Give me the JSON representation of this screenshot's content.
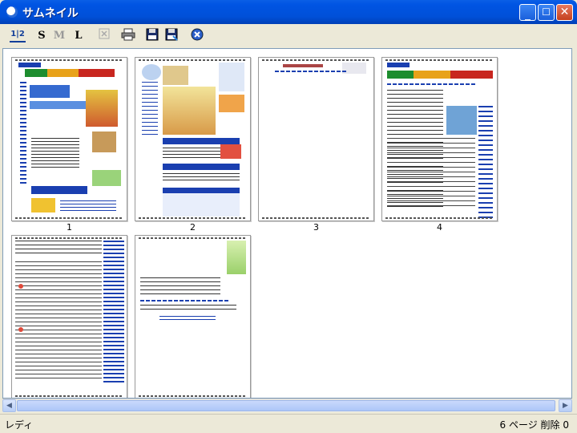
{
  "window": {
    "title": "サムネイル"
  },
  "toolbar": {
    "tools": [
      {
        "name": "page-order-icon",
        "label": "1|2"
      },
      {
        "name": "size-small-button",
        "label": "S"
      },
      {
        "name": "size-medium-button",
        "label": "M"
      },
      {
        "name": "size-large-button",
        "label": "L"
      },
      {
        "name": "delete-icon",
        "label": ""
      },
      {
        "name": "print-icon",
        "label": ""
      },
      {
        "name": "save-icon",
        "label": ""
      },
      {
        "name": "save-as-icon",
        "label": ""
      },
      {
        "name": "close-doc-icon",
        "label": ""
      }
    ]
  },
  "pages": [
    {
      "label": "1"
    },
    {
      "label": "2"
    },
    {
      "label": "3"
    },
    {
      "label": "4"
    },
    {
      "label": ""
    },
    {
      "label": ""
    }
  ],
  "status": {
    "left": "レディ",
    "right": "6 ページ  削除 0"
  },
  "colors": {
    "titlebar": "#0054e3",
    "frame": "#ece9d8"
  }
}
